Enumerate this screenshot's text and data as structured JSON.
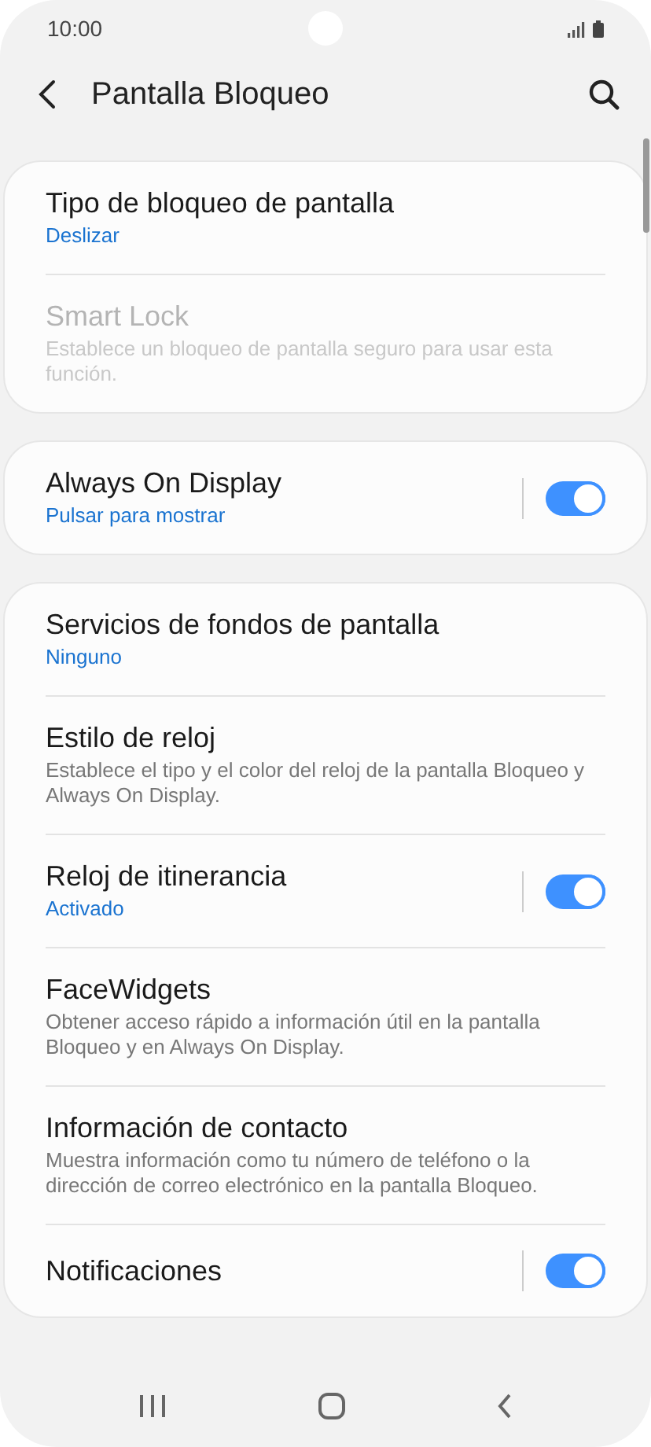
{
  "status_bar": {
    "time": "10:00"
  },
  "header": {
    "title": "Pantalla Bloqueo"
  },
  "sections": [
    {
      "items": [
        {
          "title": "Tipo de bloqueo de pantalla",
          "subtitle": {
            "text": "Deslizar",
            "kind": "value"
          },
          "disabled": false
        },
        {
          "title": "Smart Lock",
          "subtitle": {
            "text": "Establece un bloqueo de pantalla seguro para usar esta función.",
            "kind": "description"
          },
          "disabled": true
        }
      ]
    },
    {
      "items": [
        {
          "title": "Always On Display",
          "subtitle": {
            "text": "Pulsar para mostrar",
            "kind": "value"
          },
          "disabled": false,
          "toggle": {
            "on": true
          }
        }
      ]
    },
    {
      "items": [
        {
          "title": "Servicios de fondos de pantalla",
          "subtitle": {
            "text": "Ninguno",
            "kind": "value"
          },
          "disabled": false
        },
        {
          "title": "Estilo de reloj",
          "subtitle": {
            "text": "Establece el tipo y el color del reloj de la pantalla Bloqueo y Always On Display.",
            "kind": "description"
          },
          "disabled": false
        },
        {
          "title": "Reloj de itinerancia",
          "subtitle": {
            "text": "Activado",
            "kind": "value"
          },
          "disabled": false,
          "toggle": {
            "on": true
          }
        },
        {
          "title": "FaceWidgets",
          "subtitle": {
            "text": "Obtener acceso rápido a información útil en la pantalla Bloqueo y en Always On Display.",
            "kind": "description"
          },
          "disabled": false
        },
        {
          "title": "Información de contacto",
          "subtitle": {
            "text": "Muestra información como tu número de teléfono o la dirección de correo electrónico en la pantalla Bloqueo.",
            "kind": "description"
          },
          "disabled": false
        },
        {
          "title": "Notificaciones",
          "disabled": false,
          "toggle": {
            "on": true
          }
        }
      ]
    }
  ]
}
